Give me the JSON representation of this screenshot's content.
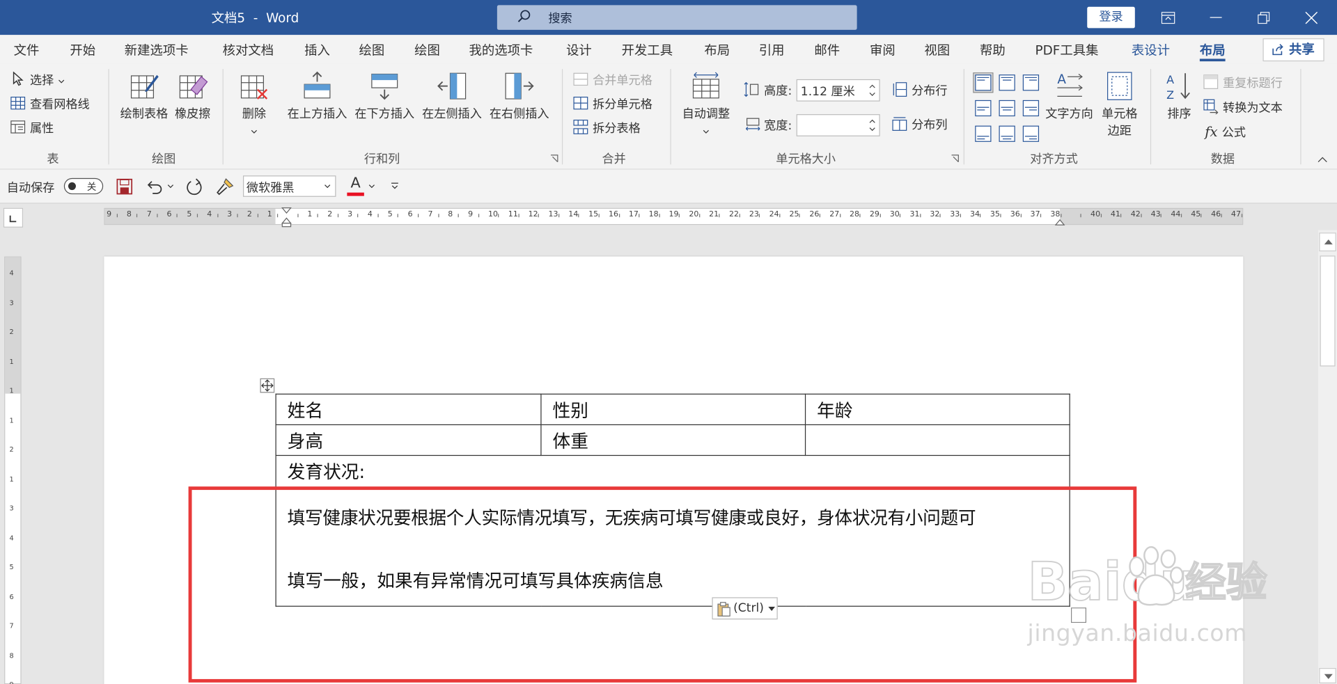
{
  "window": {
    "title": "文档5  -  Word",
    "search_label": "搜索",
    "login_label": "登录"
  },
  "tabs": [
    {
      "label": "文件"
    },
    {
      "label": "开始"
    },
    {
      "label": "新建选项卡"
    },
    {
      "label": "核对文档"
    },
    {
      "label": "插入"
    },
    {
      "label": "绘图"
    },
    {
      "label": "绘图"
    },
    {
      "label": "我的选项卡"
    },
    {
      "label": "设计"
    },
    {
      "label": "开发工具"
    },
    {
      "label": "布局"
    },
    {
      "label": "引用"
    },
    {
      "label": "邮件"
    },
    {
      "label": "审阅"
    },
    {
      "label": "视图"
    },
    {
      "label": "帮助"
    },
    {
      "label": "PDF工具集"
    },
    {
      "label": "表设计"
    },
    {
      "label": "布局"
    }
  ],
  "share_label": "共享",
  "ribbon": {
    "table_group": {
      "label": "表",
      "select": "选择",
      "gridlines": "查看网格线",
      "properties": "属性"
    },
    "draw_group": {
      "label": "绘图",
      "draw_table": "绘制表格",
      "eraser": "橡皮擦"
    },
    "rowcol_group": {
      "label": "行和列",
      "delete": "删除",
      "insert_above": "在上方插入",
      "insert_below": "在下方插入",
      "insert_left": "在左侧插入",
      "insert_right": "在右侧插入"
    },
    "merge_group": {
      "label": "合并",
      "merge_cells": "合并单元格",
      "split_cells": "拆分单元格",
      "split_table": "拆分表格"
    },
    "cellsize_group": {
      "label": "单元格大小",
      "autofit": "自动调整",
      "height_label": "高度:",
      "height_value": "1.12 厘米",
      "width_label": "宽度:",
      "width_value": "",
      "distribute_rows": "分布行",
      "distribute_cols": "分布列"
    },
    "align_group": {
      "label": "对齐方式",
      "text_direction": "文字方向",
      "cell_margins_1": "单元格",
      "cell_margins_2": "边距"
    },
    "data_group": {
      "label": "数据",
      "sort": "排序",
      "repeat_header": "重复标题行",
      "convert_text": "转换为文本",
      "formula": "公式"
    }
  },
  "qat": {
    "autosave_label": "自动保存",
    "autosave_state": "关",
    "font_name": "微软雅黑",
    "font_color_letter": "A",
    "font_color": "#e81123"
  },
  "ruler": {
    "h_labels": [
      "9",
      "8",
      "7",
      "6",
      "5",
      "4",
      "3",
      "2",
      "1",
      "",
      "1",
      "2",
      "3",
      "4",
      "5",
      "6",
      "7",
      "8",
      "9",
      "10",
      "11",
      "12",
      "13",
      "14",
      "15",
      "16",
      "17",
      "18",
      "19",
      "20",
      "21",
      "22",
      "23",
      "24",
      "25",
      "26",
      "27",
      "28",
      "29",
      "30",
      "31",
      "32",
      "33",
      "34",
      "35",
      "36",
      "37",
      "38",
      "",
      "40",
      "41",
      "42",
      "43",
      "44",
      "45",
      "46",
      "47"
    ],
    "v_labels": [
      "4",
      "3",
      "2",
      "1",
      "1",
      "1",
      "2",
      "1",
      "3",
      "4",
      "5",
      "6",
      "7",
      "8",
      "9"
    ]
  },
  "table": {
    "row1": [
      "姓名",
      "性别",
      "年龄"
    ],
    "row2": [
      "身高",
      "体重",
      ""
    ],
    "row3_heading": "发育状况:",
    "row3_body": [
      "填写健康状况要根据个人实际情况填写，无疾病可填写健康或良好，身体状况有小问题可",
      "填写一般，如果有异常情况可填写具体疾病信息"
    ]
  },
  "paste_options": "(Ctrl)",
  "watermark": {
    "brand": "Baidu",
    "brand_cn": "经验",
    "url": "jingyan.baidu.com"
  },
  "colors": {
    "accent": "#2b579a",
    "highlight": "#e83a3a"
  }
}
